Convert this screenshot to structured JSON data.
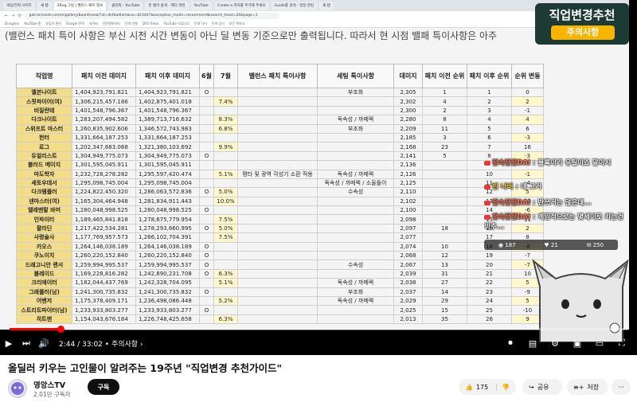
{
  "browser": {
    "tabs": [
      "게임/전략 사이트",
      "새 탭",
      "2Bug 그릴 | 밸런스 패치 정보",
      "클리픽 - YouTube",
      "돈 벌어 볼게 - 메디 관련",
      "YouTube",
      "Create a 목차를 추가해 주세요",
      "Guide를 검색 - 일일 관련",
      "새 탭"
    ],
    "url": "gall.dcinside.com/mgallery/board/view/?id=dnfbadlam&no=823447&exception_mode=recommend&search_head=20&page=1",
    "bookmarks": [
      "Dungeon",
      "YouTube 홈",
      "유튜브 관리",
      "Google 번역",
      "네이버",
      "던전앤파이터",
      "던파 인벤",
      "DFO Sekai",
      "YouTube 스튜디오",
      "던파 닥터",
      "던파 공식",
      "모든 북마크"
    ]
  },
  "slide": {
    "subtitle": "(밸런스 패치 특이 사항은 부신 시전 시간 변동이 아닌 딜 변동 기준으로만 출력됩니다. 따라서 현 시점 밸패 특이사항은 아주"
  },
  "sheet": {
    "headers": [
      "직업명",
      "패치 이전 데미지",
      "패치 이후 데미지",
      "6월",
      "7월",
      "밸런스 패치 특이사항",
      "세팅 특이사항",
      "데미지",
      "패치 이전 순위",
      "패치 이후 순위",
      "순위 변동"
    ],
    "rows": [
      [
        "엘븐나이트",
        "1,404,923,791.821",
        "1,404,923,791.821",
        "O",
        "",
        "",
        "부조화",
        "2,305",
        "1",
        "1",
        "0"
      ],
      [
        "스핏파이어(여)",
        "1,306,215,457.186",
        "1,402,875,401.018",
        "",
        "7.4%",
        "",
        "",
        "2,302",
        "4",
        "2",
        "2"
      ],
      [
        "비질란테",
        "1,401,548,796.367",
        "1,401,548,796.367",
        "",
        "",
        "",
        "",
        "2,300",
        "2",
        "3",
        "-1"
      ],
      [
        "다크나이트",
        "1,283,207,494.582",
        "1,389,713,716.632",
        "",
        "8.3%",
        "",
        "독속성 / 까메렉",
        "2,280",
        "8",
        "4",
        "4"
      ],
      [
        "스위프트 마스터",
        "1,260,835,902.606",
        "1,346,572,743.983",
        "",
        "6.8%",
        "",
        "부조화",
        "2,209",
        "11",
        "5",
        "6"
      ],
      [
        "헌터",
        "1,331,664,187.253",
        "1,331,664,187.253",
        "",
        "",
        "",
        "",
        "2,185",
        "3",
        "6",
        "-3"
      ],
      [
        "로그",
        "1,202,347,683.068",
        "1,321,380,103.692",
        "",
        "9.9%",
        "",
        "",
        "2,168",
        "23",
        "7",
        "16"
      ],
      [
        "듀얼리스트",
        "1,304,949,775.073",
        "1,304,949,775.073",
        "O",
        "",
        "",
        "",
        "2,141",
        "5",
        "8",
        "-3"
      ],
      [
        "블러드 메이지",
        "1,301,595,045.911",
        "1,301,595,045.911",
        "",
        "",
        "",
        "",
        "2,136",
        "",
        "",
        ""
      ],
      [
        "마도학자",
        "1,232,728,278.282",
        "1,295,597,420.474",
        "",
        "5.1%",
        "평타 및 광역 각성기 소환 적용",
        "독속성 / 까메렉",
        "2,126",
        "",
        "10",
        "-1"
      ],
      [
        "세토우데서",
        "1,295,098,745.004",
        "1,295,098,745.004",
        "",
        "",
        "",
        "독속성 / 까메렉 / 소울돌이",
        "2,125",
        "",
        "11",
        "-4"
      ],
      [
        "다크템플러",
        "1,224,822,450.320",
        "1,286,063,572.836",
        "O",
        "5.0%",
        "",
        "수속성",
        "2,110",
        "",
        "12",
        "5"
      ],
      [
        "넨마스터(여)",
        "1,165,304,464.948",
        "1,281,834,911.443",
        "",
        "10.0%",
        "",
        "",
        "2,102",
        "",
        "13",
        "13"
      ],
      [
        "엘레멘탈 바머",
        "1,280,048,998.525",
        "1,280,048,998.525",
        "O",
        "",
        "",
        "",
        "2,100",
        "",
        "14",
        "-6"
      ],
      [
        "인파이터",
        "1,189,465,841.818",
        "1,278,675,779.954",
        "",
        "7.5%",
        "",
        "",
        "2,098",
        "",
        "15",
        "11"
      ],
      [
        "팔라딘",
        "1,217,422,534.281",
        "1,278,293,660.995",
        "O",
        "5.0%",
        "",
        "",
        "2,097",
        "18",
        "16",
        "2"
      ],
      [
        "사령술사",
        "1,177,769,957.573",
        "1,266,102,704.391",
        "",
        "7.5%",
        "",
        "",
        "2,077",
        "",
        "17",
        "8"
      ],
      [
        "카오스",
        "1,264,146,038.189",
        "1,264,146,038.189",
        "O",
        "",
        "",
        "",
        "2,074",
        "10",
        "18",
        "-8"
      ],
      [
        "쿠노이치",
        "1,260,220,152.840",
        "1,260,220,152.840",
        "O",
        "",
        "",
        "",
        "2,068",
        "12",
        "19",
        "-7"
      ],
      [
        "드래고니안 랜서",
        "1,259,994,995.537",
        "1,259,994,995.537",
        "O",
        "",
        "",
        "수속성",
        "2,067",
        "13",
        "20",
        "-7"
      ],
      [
        "블레이드",
        "1,169,228,816.282",
        "1,242,890,231.708",
        "O",
        "6.3%",
        "",
        "",
        "2,039",
        "31",
        "21",
        "10"
      ],
      [
        "크리에이터",
        "1,182,044,437.769",
        "1,242,328,704.095",
        "",
        "5.1%",
        "",
        "독속성 / 까메렉",
        "2,038",
        "27",
        "22",
        "5"
      ],
      [
        "그래플러(남)",
        "1,241,300,735.832",
        "1,241,300,735.832",
        "O",
        "",
        "",
        "부조화",
        "2,037",
        "14",
        "23",
        "-9"
      ],
      [
        "어벤저",
        "1,175,378,409.171",
        "1,236,498,086.448",
        "",
        "5.2%",
        "",
        "독속성 / 까메렉",
        "2,029",
        "29",
        "24",
        "5"
      ],
      [
        "스트리트파이터(남)",
        "1,233,933,803.277",
        "1,233,933,803.277",
        "O",
        "",
        "",
        "",
        "2,025",
        "15",
        "25",
        "-10"
      ],
      [
        "히트맨",
        "1,154,043,676.184",
        "1,226,748,425.658",
        "",
        "6.3%",
        "",
        "",
        "2,013",
        "35",
        "26",
        "9"
      ]
    ]
  },
  "overlay": {
    "badge_title": "직업변경추천",
    "badge_sub": "주의사항",
    "chat": [
      {
        "name": "전속전전DAI",
        "text": "블록이가 유틸이죠 말이시"
      },
      {
        "name": "빈 나버",
        "text": "네 그거"
      },
      {
        "name": "전속전전DAI",
        "text": "반쓰거는 않은데..."
      },
      {
        "name": "전속전전DAI",
        "text": "게임적으로는 몇세이로 카는건 비추..."
      }
    ],
    "stats": [
      "187",
      "21",
      "250"
    ]
  },
  "player": {
    "time": "2:44 / 33:02",
    "chapter": "주의사항",
    "progress": 0.083
  },
  "video": {
    "title": "올딜러 키우는 고인물이 알려주는 19주년 \"직업변경 추천가이드\"",
    "channel": "영앙스TV",
    "subscribers": "2.01만 구독자",
    "subscribe_label": "구독",
    "likes": "175",
    "share_label": "공유",
    "save_label": "저장",
    "more_label": "···"
  },
  "colors": {
    "progress": "#ff0000",
    "name_cell": "#f4dd8a",
    "badge_bg": "#1e3a34",
    "badge_accent": "#f7b400"
  }
}
